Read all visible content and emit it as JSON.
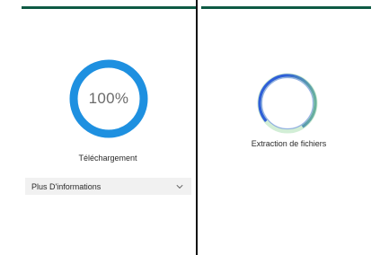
{
  "colors": {
    "top_bar": "#0e5a44",
    "divider": "#111111",
    "progress_ring": "#1e90e0",
    "progress_text": "#6b6b6b",
    "label_text": "#2a2a2a",
    "more_info_bg": "#f1f1f1",
    "spinner_blue": "#2f5fd8",
    "spinner_green": "#7fcf8a"
  },
  "download": {
    "progress_percent": 100,
    "progress_text": "100%",
    "label": "Téléchargement"
  },
  "more_info": {
    "label": "Plus D'informations",
    "chevron_icon": "chevron-down-icon"
  },
  "extraction": {
    "label": "Extraction de fichiers",
    "spinner_icon": "loading-spinner-icon"
  }
}
